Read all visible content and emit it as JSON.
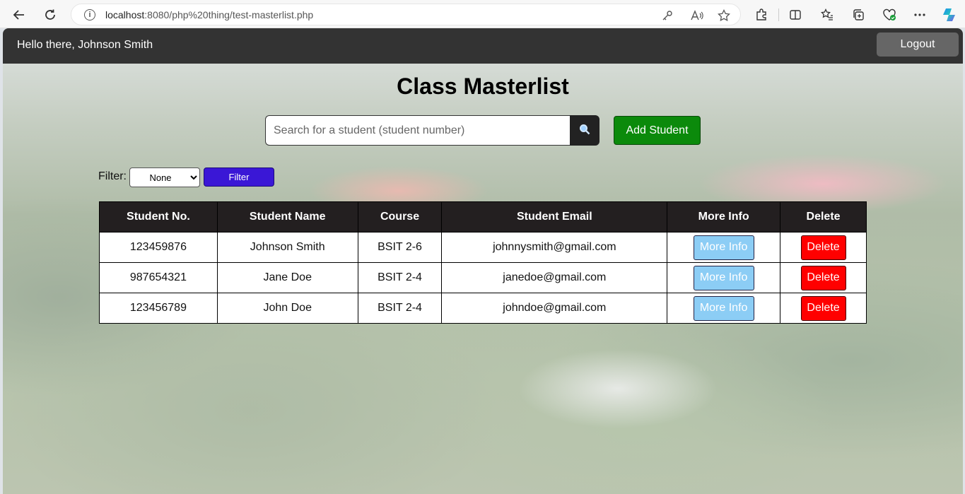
{
  "browser": {
    "url_host": "localhost",
    "url_path": ":8080/php%20thing/test-masterlist.php"
  },
  "header": {
    "greeting": "Hello there, Johnson Smith",
    "logout_label": "Logout"
  },
  "page": {
    "title": "Class Masterlist"
  },
  "search": {
    "placeholder": "Search for a student (student number)",
    "value": "",
    "add_label": "Add Student"
  },
  "filter": {
    "label": "Filter:",
    "selected": "None",
    "button_label": "Filter"
  },
  "table": {
    "columns": [
      "Student No.",
      "Student Name",
      "Course",
      "Student Email",
      "More Info",
      "Delete"
    ],
    "rows": [
      {
        "student_no": "123459876",
        "name": "Johnson Smith",
        "course": "BSIT 2-6",
        "email": "johnnysmith@gmail.com",
        "more": "More Info",
        "delete": "Delete"
      },
      {
        "student_no": "987654321",
        "name": "Jane Doe",
        "course": "BSIT 2-4",
        "email": "janedoe@gmail.com",
        "more": "More Info",
        "delete": "Delete"
      },
      {
        "student_no": "123456789",
        "name": "John Doe",
        "course": "BSIT 2-4",
        "email": "johndoe@gmail.com",
        "more": "More Info",
        "delete": "Delete"
      }
    ]
  },
  "colors": {
    "topbar": "#333333",
    "add_button": "#0b8a0b",
    "filter_button": "#3a17d6",
    "more_info_button": "#8ccdf5",
    "delete_button": "#ff0000",
    "table_header": "#231f20"
  }
}
